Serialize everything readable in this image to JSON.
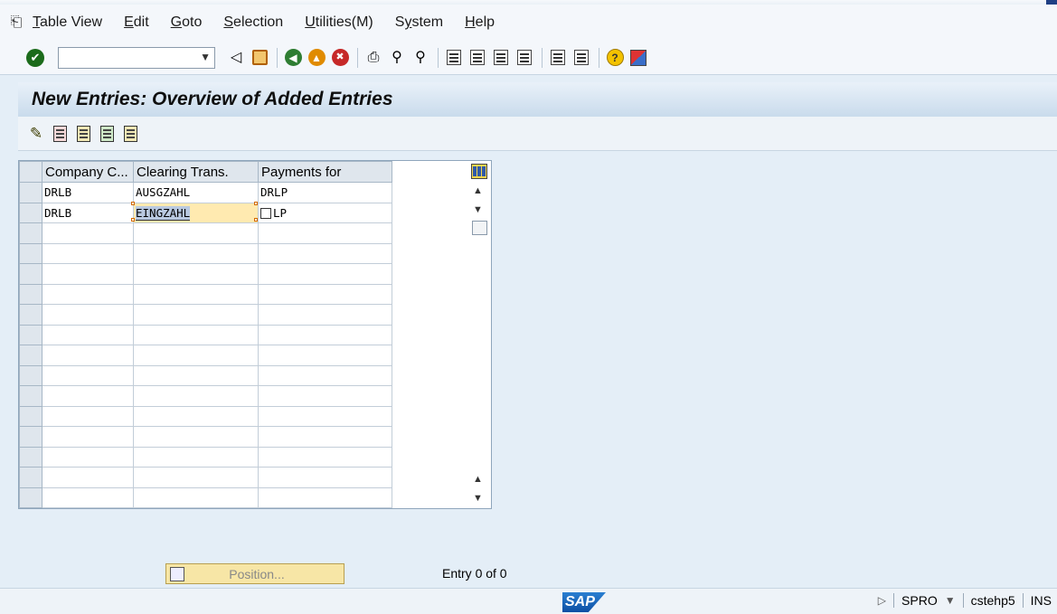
{
  "menu": {
    "items": [
      {
        "label": "Table View",
        "underline": "T"
      },
      {
        "label": "Edit",
        "underline": "E"
      },
      {
        "label": "Goto",
        "underline": "G"
      },
      {
        "label": "Selection",
        "underline": "S"
      },
      {
        "label": "Utilities(M)",
        "underline": "U"
      },
      {
        "label": "System",
        "underline": "y"
      },
      {
        "label": "Help",
        "underline": "H"
      }
    ]
  },
  "command_field": {
    "value": ""
  },
  "title": "New Entries: Overview of Added Entries",
  "table": {
    "headers": [
      "Company C...",
      "Clearing Trans.",
      "Payments for"
    ],
    "rows": [
      [
        "DRLB",
        "AUSGZAHL",
        "DRLP"
      ],
      [
        "DRLB",
        "EINGZAHL",
        "LP"
      ]
    ],
    "empty_rows": 14
  },
  "position_button": {
    "label": "Position..."
  },
  "entry_count": "Entry 0 of 0",
  "status": {
    "logo": "SAP",
    "transaction": "SPRO",
    "system": "cstehp5",
    "mode": "INS"
  }
}
